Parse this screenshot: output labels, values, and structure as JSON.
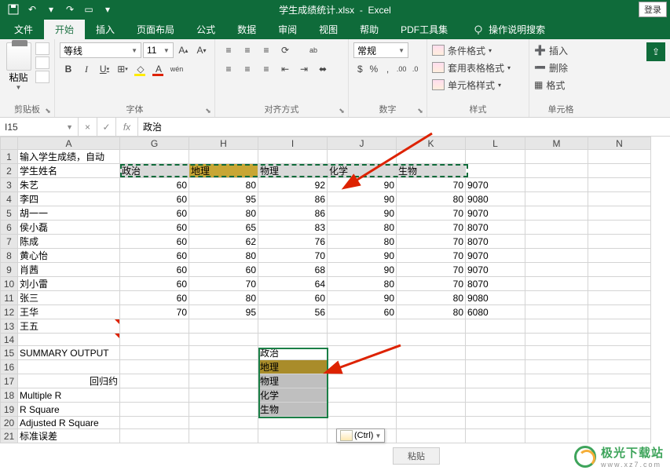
{
  "titlebar": {
    "filename": "学生成绩统计.xlsx",
    "appname": "Excel",
    "login": "登录"
  },
  "tabs": {
    "file": "文件",
    "home": "开始",
    "insert": "插入",
    "layout": "页面布局",
    "formulas": "公式",
    "data": "数据",
    "review": "审阅",
    "view": "视图",
    "help": "帮助",
    "pdf": "PDF工具集",
    "tellme": "操作说明搜索"
  },
  "ribbon": {
    "clipboard": {
      "paste": "粘贴",
      "group": "剪贴板"
    },
    "font": {
      "name": "等线",
      "size": "11",
      "group": "字体",
      "wen": "wén"
    },
    "align": {
      "group": "对齐方式",
      "wrap": "ab"
    },
    "number": {
      "format": "常规",
      "group": "数字"
    },
    "styles": {
      "cond": "条件格式",
      "table": "套用表格格式",
      "cell": "单元格样式",
      "group": "样式"
    },
    "cells": {
      "insert": "插入",
      "delete": "删除",
      "format": "格式",
      "group": "单元格"
    }
  },
  "namebox": "I15",
  "formula": "政治",
  "columns": [
    "A",
    "G",
    "H",
    "I",
    "J",
    "K",
    "L",
    "M",
    "N"
  ],
  "rows": [
    {
      "n": 1,
      "A": "输入学生成绩，自动"
    },
    {
      "n": 2,
      "A": "学生姓名",
      "G": "政治",
      "H": "地理",
      "I": "物理",
      "J": "化学",
      "K": "生物"
    },
    {
      "n": 3,
      "A": "朱艺",
      "G": "60",
      "H": "80",
      "I": "92",
      "J": "90",
      "K": "70",
      "L": "9070"
    },
    {
      "n": 4,
      "A": "李四",
      "G": "60",
      "H": "95",
      "I": "86",
      "J": "90",
      "K": "80",
      "L": "9080"
    },
    {
      "n": 5,
      "A": "胡一一",
      "G": "60",
      "H": "80",
      "I": "86",
      "J": "90",
      "K": "70",
      "L": "9070"
    },
    {
      "n": 6,
      "A": "侯小磊",
      "G": "60",
      "H": "65",
      "I": "83",
      "J": "80",
      "K": "70",
      "L": "8070"
    },
    {
      "n": 7,
      "A": "陈成",
      "G": "60",
      "H": "62",
      "I": "76",
      "J": "80",
      "K": "70",
      "L": "8070"
    },
    {
      "n": 8,
      "A": "黄心怡",
      "G": "60",
      "H": "80",
      "I": "70",
      "J": "90",
      "K": "70",
      "L": "9070"
    },
    {
      "n": 9,
      "A": "肖茜",
      "G": "60",
      "H": "60",
      "I": "68",
      "J": "90",
      "K": "70",
      "L": "9070"
    },
    {
      "n": 10,
      "A": "刘小雷",
      "G": "60",
      "H": "70",
      "I": "64",
      "J": "80",
      "K": "70",
      "L": "8070"
    },
    {
      "n": 11,
      "A": "张三",
      "G": "60",
      "H": "80",
      "I": "60",
      "J": "90",
      "K": "80",
      "L": "9080"
    },
    {
      "n": 12,
      "A": "王华",
      "G": "70",
      "H": "95",
      "I": "56",
      "J": "60",
      "K": "80",
      "L": "6080"
    },
    {
      "n": 13,
      "A": "王五"
    },
    {
      "n": 14
    },
    {
      "n": 15,
      "A": "SUMMARY OUTPUT",
      "I": "政治"
    },
    {
      "n": 16,
      "I": "地理"
    },
    {
      "n": 17,
      "A": "回归约",
      "I": "物理"
    },
    {
      "n": 18,
      "A": "Multiple R",
      "I": "化学"
    },
    {
      "n": 19,
      "A": "R Square",
      "I": "生物"
    },
    {
      "n": 20,
      "A": "Adjusted R Square"
    },
    {
      "n": 21,
      "A": "标准误差"
    }
  ],
  "paste_pop": "(Ctrl)",
  "paste_label": "粘贴",
  "watermark": {
    "text": "极光下载站",
    "sub": "www.xz7.com"
  }
}
